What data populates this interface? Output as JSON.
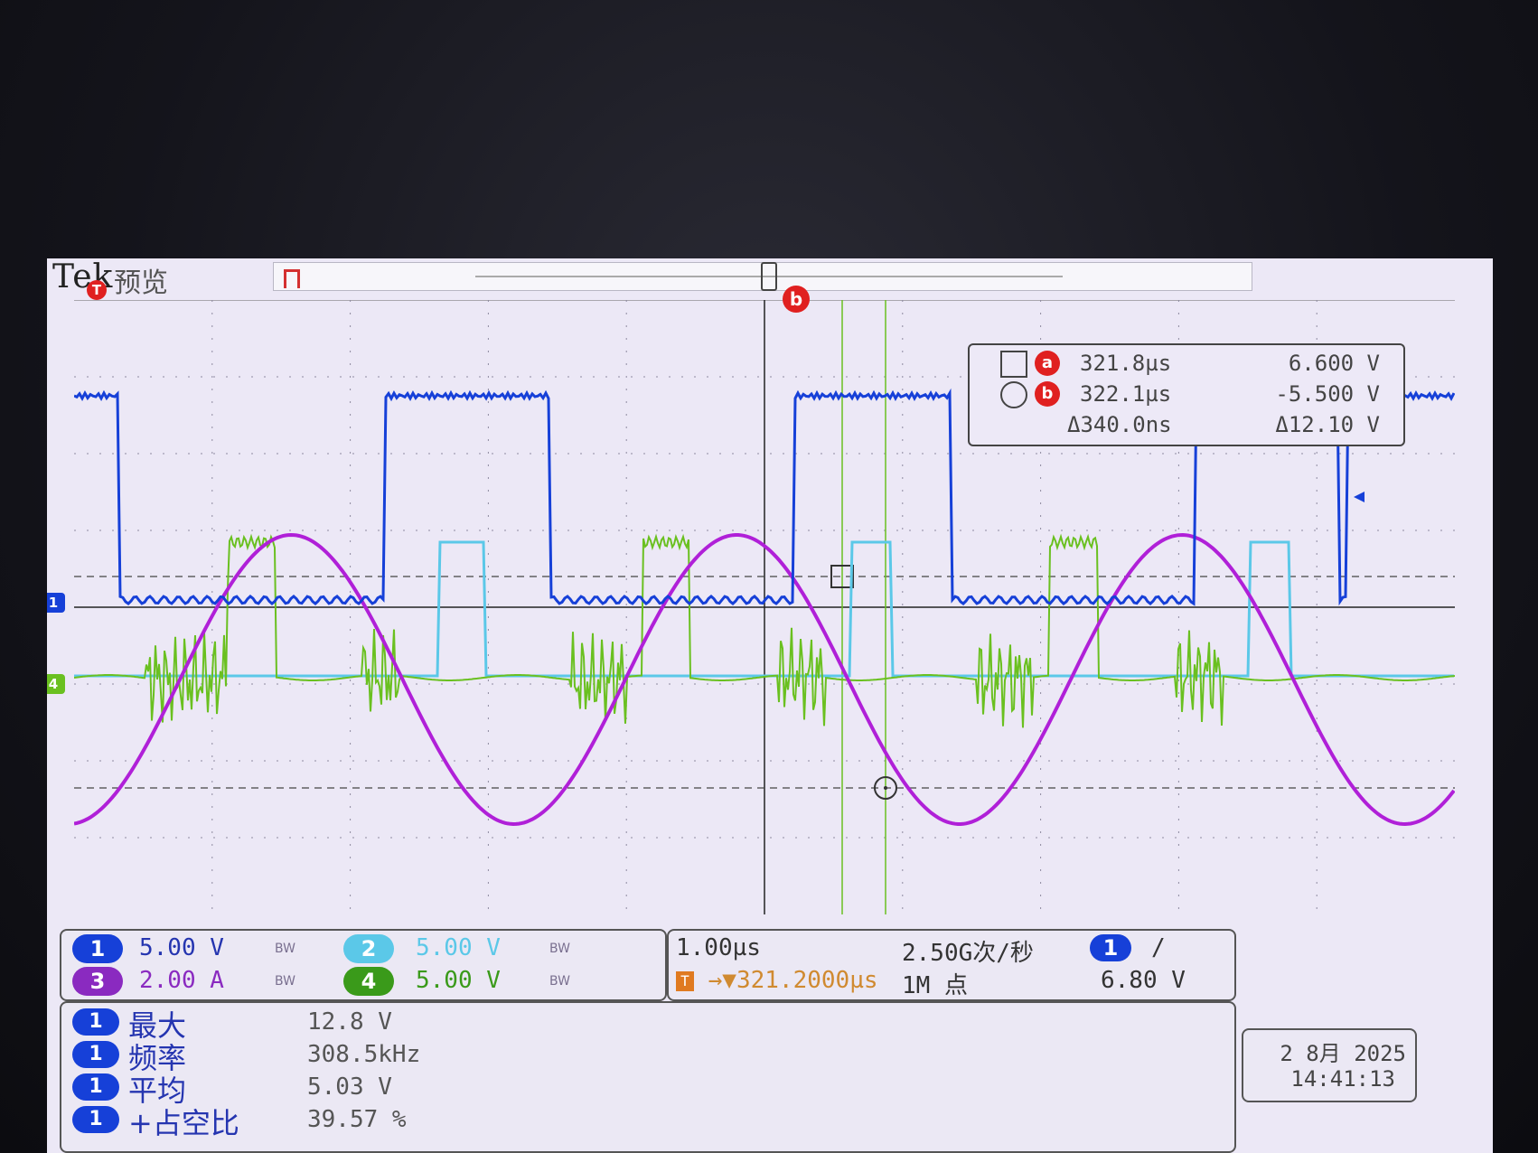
{
  "header": {
    "brand": "Tek",
    "mode": "预览"
  },
  "cursors": {
    "trigger_flag": "T",
    "cursor_b_label": "b",
    "readout": {
      "a": {
        "badge": "a",
        "time": "321.8µs",
        "value": "6.600 V"
      },
      "b": {
        "badge": "b",
        "time": "322.1µs",
        "value": "-5.500 V"
      },
      "delta": {
        "time": "Δ340.0ns",
        "value": "Δ12.10 V"
      }
    }
  },
  "ground_markers": {
    "ch1": "1",
    "ch4": "4"
  },
  "channels": [
    {
      "num": "1",
      "scale": "5.00 V",
      "bw": "BW",
      "color": "#1640d8"
    },
    {
      "num": "2",
      "scale": "5.00 V",
      "bw": "BW",
      "color": "#5bc8e8"
    },
    {
      "num": "3",
      "scale": "2.00 A",
      "bw": "BW",
      "color": "#8a2ac0"
    },
    {
      "num": "4",
      "scale": "5.00 V",
      "bw": "BW",
      "color": "#3a9a1a"
    }
  ],
  "timebase": {
    "scale": "1.00µs",
    "sample_rate": "2.50G次/秒",
    "position": "321.2000µs",
    "record_length": "1M 点",
    "trigger_source": "1",
    "trigger_slope": "/",
    "trigger_level": "6.80 V"
  },
  "measurements": [
    {
      "source": "1",
      "name": "最大",
      "value": "12.8 V"
    },
    {
      "source": "1",
      "name": "频率",
      "value": "308.5kHz"
    },
    {
      "source": "1",
      "name": "平均",
      "value": "5.03 V"
    },
    {
      "source": "1",
      "name": "+占空比",
      "value": "39.57 %"
    }
  ],
  "datetime": {
    "date": "2 8月 2025",
    "time": "14:41:13"
  },
  "colors": {
    "ch1": "#1640d8",
    "ch2": "#5bc8e8",
    "ch3": "#b020d8",
    "ch4": "#6ac020",
    "cursor": "#e02020",
    "background": "#ece8f6"
  }
}
